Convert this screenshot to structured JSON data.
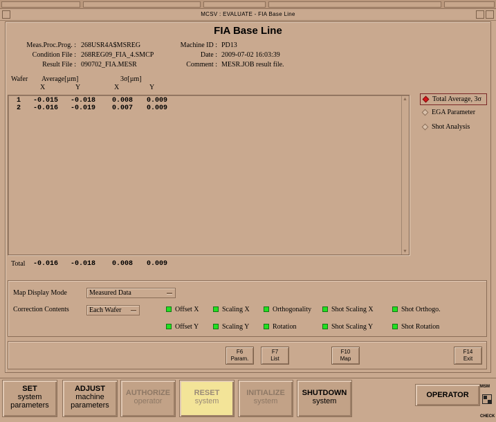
{
  "window": {
    "title": "MCSV : EVALUATE - FIA Base Line"
  },
  "page_title": "FIA Base Line",
  "info_left": [
    {
      "label": "Meas.Proc.Prog. :",
      "value": "268USR4A$MSREG"
    },
    {
      "label": "Condition File :",
      "value": "268REG09_FIA_4.SMCP"
    },
    {
      "label": "Result File :",
      "value": "090702_FIA.MESR"
    }
  ],
  "info_right": [
    {
      "label": "Machine ID :",
      "value": "PD13"
    },
    {
      "label": "Date :",
      "value": "2009-07-02 16:03:39"
    },
    {
      "label": "Comment :",
      "value": "MESR.JOB result file."
    }
  ],
  "table": {
    "col_wafer": "Wafer",
    "col_average": "Average[µm]",
    "col_3sigma": "3σ[µm]",
    "sub_x": "X",
    "sub_y": "Y",
    "rows": [
      {
        "wafer": "1",
        "avg_x": "-0.015",
        "avg_y": "-0.018",
        "s_x": "0.008",
        "s_y": "0.009"
      },
      {
        "wafer": "2",
        "avg_x": "-0.016",
        "avg_y": "-0.019",
        "s_x": "0.007",
        "s_y": "0.009"
      }
    ],
    "total": {
      "label": "Total",
      "avg_x": "-0.016",
      "avg_y": "-0.018",
      "s_x": "0.008",
      "s_y": "0.009"
    }
  },
  "view_options": [
    {
      "label": "Total Average, 3σ",
      "selected": true
    },
    {
      "label": "EGA Parameter",
      "selected": false
    },
    {
      "label": "Shot Analysis",
      "selected": false
    }
  ],
  "map_display": {
    "label": "Map Display Mode",
    "value": "Measured Data"
  },
  "correction": {
    "label": "Correction Contents",
    "value": "Each Wafer",
    "items_row1": [
      "Offset X",
      "Scaling X",
      "Orthogonality",
      "Shot Scaling X",
      "Shot Orthogo."
    ],
    "items_row2": [
      "Offset Y",
      "Scaling Y",
      "Rotation",
      "Shot Scaling Y",
      "Shot Rotation"
    ],
    "led_color": "#22e022"
  },
  "function_keys": [
    {
      "key": "F6",
      "label": "Param."
    },
    {
      "key": "F7",
      "label": "List"
    },
    {
      "key": "F10",
      "label": "Map"
    },
    {
      "key": "F14",
      "label": "Exit"
    }
  ],
  "bottom_buttons": [
    {
      "line1": "SET",
      "line2": "system",
      "line3": "parameters"
    },
    {
      "line1": "ADJUST",
      "line2": "machine",
      "line3": "parameters"
    },
    {
      "line1": "AUTHORIZE",
      "line2": "operator",
      "line3": ""
    },
    {
      "line1": "RESET",
      "line2": "system",
      "line3": ""
    },
    {
      "line1": "INITIALIZE",
      "line2": "system",
      "line3": ""
    },
    {
      "line1": "SHUTDOWN",
      "line2": "system",
      "line3": ""
    }
  ],
  "operator_button": "OPERATOR",
  "msm": {
    "top": "MSM",
    "bottom": "CHECK"
  },
  "colors": {
    "background": "#c9a98f",
    "highlight": "#f3e498",
    "selected_radio": "#d8161a"
  }
}
